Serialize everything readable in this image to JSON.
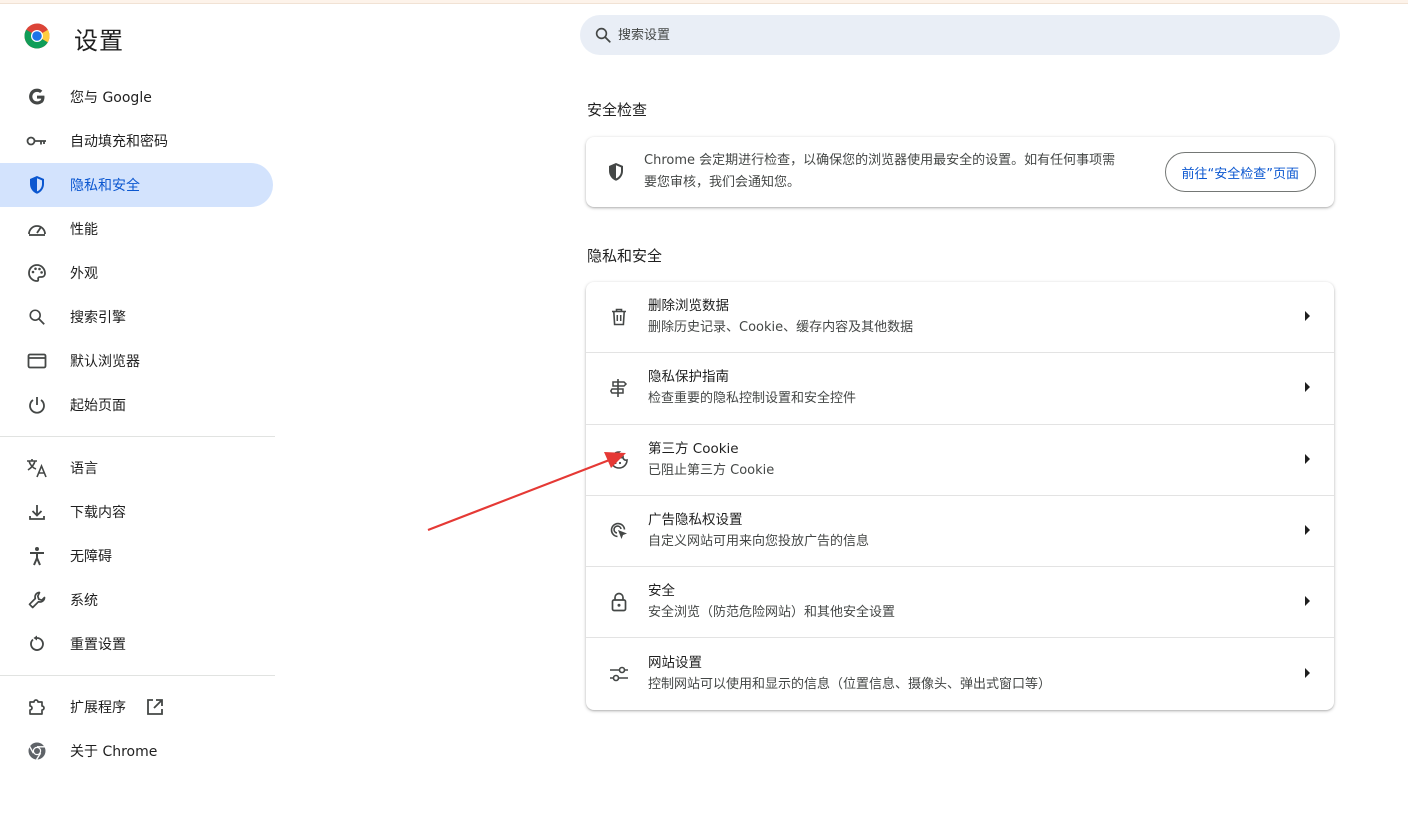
{
  "app": {
    "title": "设置"
  },
  "search": {
    "placeholder": "搜索设置"
  },
  "sidebar": {
    "items": [
      {
        "label": "您与 Google",
        "icon": "google-icon"
      },
      {
        "label": "自动填充和密码",
        "icon": "key-icon"
      },
      {
        "label": "隐私和安全",
        "icon": "shield-icon",
        "active": true
      },
      {
        "label": "性能",
        "icon": "speedometer-icon"
      },
      {
        "label": "外观",
        "icon": "palette-icon"
      },
      {
        "label": "搜索引擎",
        "icon": "search-icon"
      },
      {
        "label": "默认浏览器",
        "icon": "browser-window-icon"
      },
      {
        "label": "起始页面",
        "icon": "power-icon"
      },
      {
        "label": "语言",
        "icon": "translate-icon"
      },
      {
        "label": "下载内容",
        "icon": "download-icon"
      },
      {
        "label": "无障碍",
        "icon": "accessibility-icon"
      },
      {
        "label": "系统",
        "icon": "wrench-icon"
      },
      {
        "label": "重置设置",
        "icon": "reset-icon"
      },
      {
        "label": "扩展程序",
        "icon": "puzzle-icon"
      },
      {
        "label": "关于 Chrome",
        "icon": "chrome-icon"
      }
    ]
  },
  "safety_check": {
    "section_title": "安全检查",
    "text": "Chrome 会定期进行检查，以确保您的浏览器使用最安全的设置。如有任何事项需要您审核，我们会通知您。",
    "button_label": "前往“安全检查”页面"
  },
  "privacy": {
    "section_title": "隐私和安全",
    "rows": [
      {
        "title": "删除浏览数据",
        "subtitle": "删除历史记录、Cookie、缓存内容及其他数据",
        "icon": "trash-icon"
      },
      {
        "title": "隐私保护指南",
        "subtitle": "检查重要的隐私控制设置和安全控件",
        "icon": "signpost-icon"
      },
      {
        "title": "第三方 Cookie",
        "subtitle": "已阻止第三方 Cookie",
        "icon": "cookie-icon"
      },
      {
        "title": "广告隐私权设置",
        "subtitle": "自定义网站可用来向您投放广告的信息",
        "icon": "ad-privacy-icon"
      },
      {
        "title": "安全",
        "subtitle": "安全浏览（防范危险网站）和其他安全设置",
        "icon": "lock-icon"
      },
      {
        "title": "网站设置",
        "subtitle": "控制网站可以使用和显示的信息（位置信息、摄像头、弹出式窗口等）",
        "icon": "tune-icon"
      }
    ]
  },
  "colors": {
    "accent": "#0b57d0",
    "active_bg": "#d3e3fd",
    "search_bg": "#e9eef6",
    "annotation_arrow": "#e53935"
  }
}
